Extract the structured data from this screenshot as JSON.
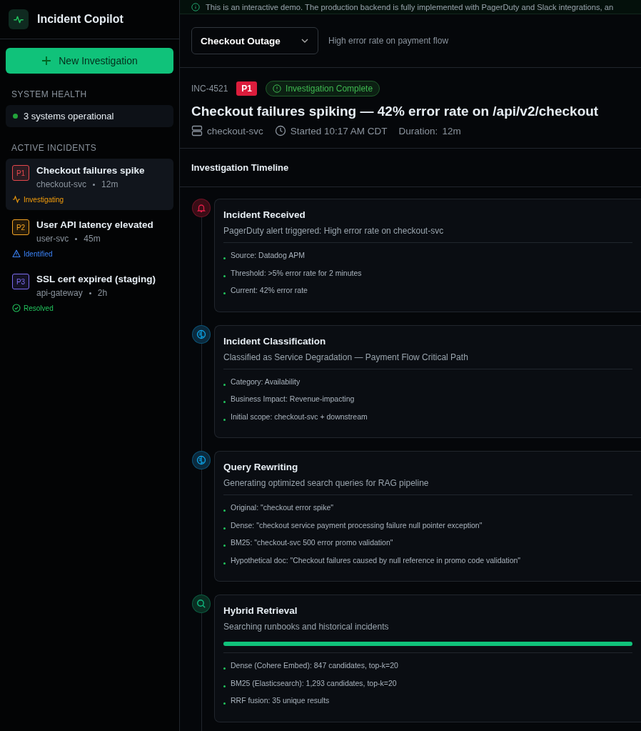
{
  "sidebar": {
    "app_title": "Incident Copilot",
    "new_button": "New Investigation",
    "health_heading": "SYSTEM HEALTH",
    "health_status": "3 systems operational",
    "incidents_heading": "ACTIVE INCIDENTS",
    "incidents": [
      {
        "priority": "P1",
        "color": "#e5484d",
        "title": "Checkout failures spike",
        "service": "checkout-svc",
        "age": "12m",
        "status": {
          "kind": "investigating",
          "label": "Investigating"
        },
        "selected": true
      },
      {
        "priority": "P2",
        "color": "#f5a524",
        "title": "User API latency elevated",
        "service": "user-svc",
        "age": "45m",
        "status": {
          "kind": "identified",
          "label": "Identified"
        },
        "selected": false
      },
      {
        "priority": "P3",
        "color": "#7c6cf0",
        "title": "SSL cert expired (staging)",
        "service": "api-gateway",
        "age": "2h",
        "status": {
          "kind": "resolved",
          "label": "Resolved"
        },
        "selected": false
      }
    ]
  },
  "banner": "This is an interactive demo. The production backend is fully implemented with PagerDuty and Slack integrations, an",
  "scenario": {
    "value": "Checkout Outage",
    "description": "High error rate on payment flow"
  },
  "incident": {
    "id": "INC-4521",
    "priority": "P1",
    "status": "Investigation Complete",
    "title": "Checkout failures spiking — 42% error rate on /api/v2/checkout",
    "service": "checkout-svc",
    "started": "Started 10:17 AM CDT",
    "duration_label": "Duration:",
    "duration": "12m"
  },
  "timeline": {
    "heading": "Investigation Timeline",
    "steps": [
      {
        "kind": "alert",
        "title": "Incident Received",
        "subtitle": "PagerDuty alert triggered: High error rate on checkout-svc",
        "details": [
          "Source: Datadog APM",
          "Threshold: >5% error rate for 2 minutes",
          "Current: 42% error rate"
        ]
      },
      {
        "kind": "analysis",
        "title": "Incident Classification",
        "subtitle": "Classified as Service Degradation — Payment Flow Critical Path",
        "details": [
          "Category: Availability",
          "Business Impact: Revenue-impacting",
          "Initial scope: checkout-svc + downstream"
        ]
      },
      {
        "kind": "analysis",
        "title": "Query Rewriting",
        "subtitle": "Generating optimized search queries for RAG pipeline",
        "details": [
          "Original: \"checkout error spike\"",
          "Dense: \"checkout service payment processing failure null pointer exception\"",
          "BM25: \"checkout-svc 500 error promo validation\"",
          "Hypothetical doc: \"Checkout failures caused by null reference in promo code validation\""
        ]
      },
      {
        "kind": "search",
        "title": "Hybrid Retrieval",
        "subtitle": "Searching runbooks and historical incidents",
        "level": 1,
        "details": [
          "Dense (Cohere Embed): 847 candidates, top-k=20",
          "BM25 (Elasticsearch): 1,293 candidates, top-k=20",
          "RRF fusion: 35 unique results"
        ]
      }
    ]
  }
}
